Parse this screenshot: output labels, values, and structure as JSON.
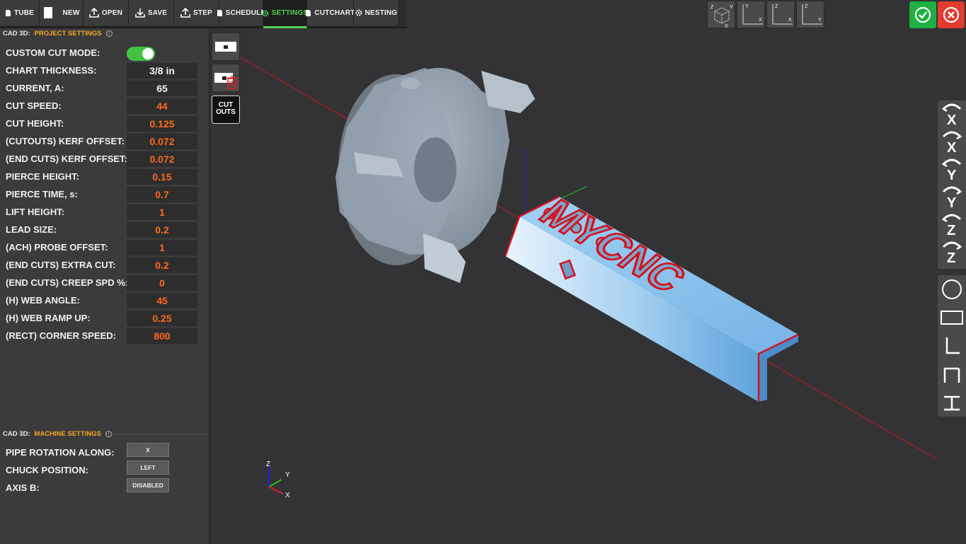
{
  "toolbar": [
    {
      "label": "TUBE",
      "icon": "file-icon",
      "active": false
    },
    {
      "label": "NEW",
      "icon": "blank-page-icon",
      "active": false
    },
    {
      "label": "OPEN",
      "icon": "upload-icon",
      "active": false
    },
    {
      "label": "SAVE",
      "icon": "download-icon",
      "active": false
    },
    {
      "label": "STEP",
      "icon": "upload-icon",
      "active": false
    },
    {
      "label": "SCHEDULE",
      "icon": "file-icon",
      "active": false
    },
    {
      "label": "SETTINGS",
      "icon": "gear-icon",
      "active": true
    },
    {
      "label": "CUTCHART",
      "icon": "file-icon",
      "active": false
    },
    {
      "label": "NESTING",
      "icon": "gear-icon",
      "active": false
    }
  ],
  "views": {
    "iso": {
      "a": "Z",
      "b": "Y",
      "c": "X"
    },
    "xy": {
      "a": "Y",
      "b": "X"
    },
    "xz": {
      "a": "Z",
      "b": "X"
    },
    "yz": {
      "a": "Z",
      "b": "Y"
    }
  },
  "colors": {
    "accent": "#f5a623",
    "value": "#ff6a1a",
    "confirm": "#1db954",
    "cancel": "#e53935",
    "tube": "#8cc4ef",
    "cut": "#d8101a"
  },
  "project": {
    "section": "CAD 3D:",
    "title": "PROJECT SETTINGS",
    "custom_cut_mode": {
      "label": "CUSTOM CUT MODE:",
      "on": true
    },
    "rows": [
      {
        "label": "CHART THICKNESS:",
        "value": "3/8 in",
        "color": "w"
      },
      {
        "label": "CURRENT, A:",
        "value": "65",
        "color": "w"
      },
      {
        "label": "CUT SPEED:",
        "value": "44",
        "color": "o"
      },
      {
        "label": "CUT HEIGHT:",
        "value": "0.125",
        "color": "o"
      },
      {
        "label": "(CUTOUTS) KERF OFFSET:",
        "value": "0.072",
        "color": "o"
      },
      {
        "label": "(END CUTS) KERF OFFSET:",
        "value": "0.072",
        "color": "o"
      },
      {
        "label": "PIERCE HEIGHT:",
        "value": "0.15",
        "color": "o"
      },
      {
        "label": "PIERCE TIME, s:",
        "value": "0.7",
        "color": "o"
      },
      {
        "label": "LIFT HEIGHT:",
        "value": "1",
        "color": "o"
      },
      {
        "label": "LEAD SIZE:",
        "value": "0.2",
        "color": "o"
      },
      {
        "label": "(ACH) PROBE OFFSET:",
        "value": "1",
        "color": "o"
      },
      {
        "label": "(END CUTS) EXTRA CUT:",
        "value": "0.2",
        "color": "o"
      },
      {
        "label": "(END CUTS) CREEP SPD %:",
        "value": "0",
        "color": "o"
      },
      {
        "label": "(H) WEB ANGLE:",
        "value": "45",
        "color": "o"
      },
      {
        "label": "(H) WEB RAMP UP:",
        "value": "0.25",
        "color": "o"
      },
      {
        "label": "(RECT) CORNER SPEED:",
        "value": "800",
        "color": "o"
      }
    ]
  },
  "machine": {
    "section": "CAD 3D:",
    "title": "MACHINE SETTINGS",
    "rows": [
      {
        "label": "PIPE ROTATION ALONG:",
        "value": "X"
      },
      {
        "label": "CHUCK POSITION:",
        "value": "LEFT"
      },
      {
        "label": "AXIS B:",
        "value": "DISABLED"
      }
    ]
  },
  "side_tools": {
    "cutouts_label": "CUT\nOUTS"
  },
  "rotate_tools": [
    "rotate-x-ccw",
    "rotate-x-cw",
    "rotate-y-ccw",
    "rotate-y-cw",
    "rotate-z-ccw",
    "rotate-z-cw"
  ],
  "rotate_letters": [
    "X",
    "X",
    "Y",
    "Y",
    "Z",
    "Z"
  ],
  "shape_tools": [
    "round-tube-icon",
    "rect-tube-icon",
    "angle-icon",
    "channel-icon",
    "h-beam-icon"
  ],
  "axes": {
    "z": "Z",
    "y": "Y",
    "x": "X"
  },
  "engraving": "MYCNC"
}
